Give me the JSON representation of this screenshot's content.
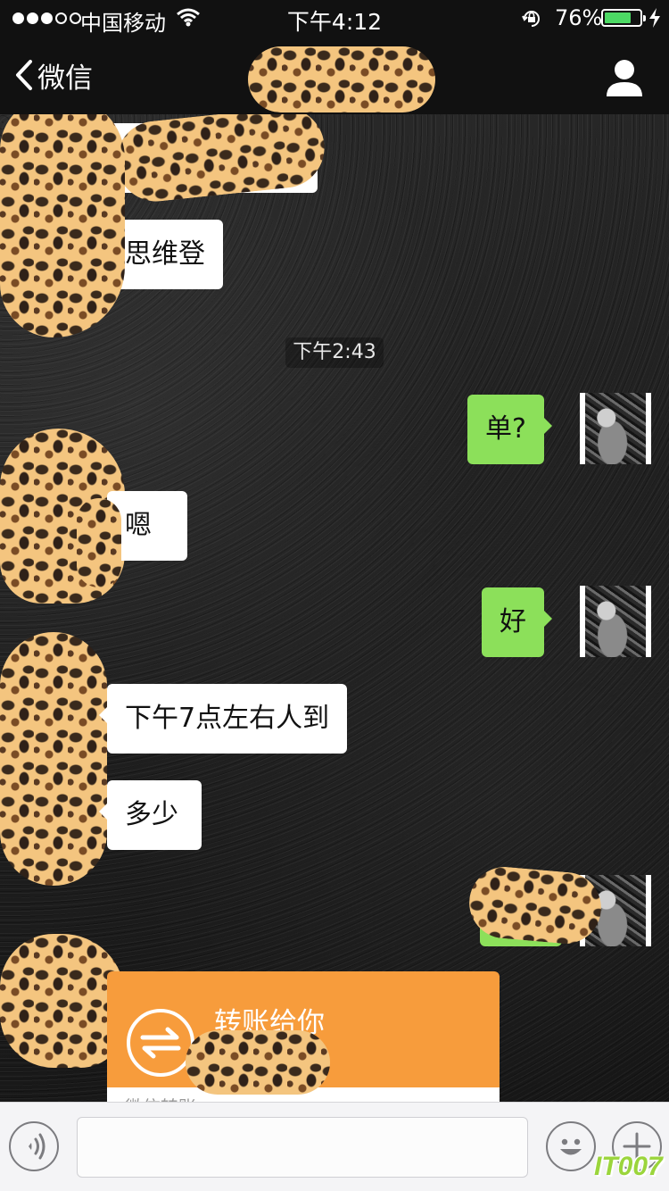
{
  "status_bar": {
    "carrier": "中国移动",
    "time": "下午4:12",
    "battery_percent": "76%",
    "battery_level": 0.76,
    "signal_bars_filled": 3,
    "signal_bars_total": 5
  },
  "nav": {
    "back_label": "微信",
    "back_icon": "chevron-left-icon",
    "profile_icon": "person-icon"
  },
  "colors": {
    "outgoing_bubble": "#8ce05a",
    "incoming_bubble": "#ffffff",
    "transfer_card": "#f79c3c",
    "battery": "#4cd964"
  },
  "messages": [
    {
      "direction": "in",
      "text": "思维登"
    },
    {
      "direction": "time",
      "text": "下午2:43"
    },
    {
      "direction": "out",
      "text": "单?"
    },
    {
      "direction": "in",
      "text": "嗯"
    },
    {
      "direction": "out",
      "text": "好"
    },
    {
      "direction": "in",
      "text": "下午7点左右人到"
    },
    {
      "direction": "in",
      "text": "多少"
    }
  ],
  "transfer": {
    "title": "转账给你",
    "footer": "微信转账",
    "icon": "transfer-arrows-icon"
  },
  "input_bar": {
    "voice_icon": "voice-icon",
    "emoji_icon": "emoji-icon",
    "plus_icon": "plus-icon",
    "text_value": ""
  },
  "watermark": "IT007"
}
